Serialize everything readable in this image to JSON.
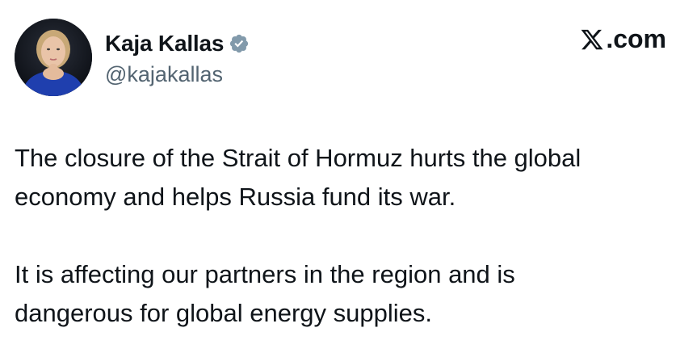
{
  "author": {
    "display_name": "Kaja Kallas",
    "handle": "@kajakallas",
    "verified_icon": "verified-badge-icon",
    "verified_color": "#829aab"
  },
  "brand": {
    "label": ".com",
    "icon": "x-logo-icon"
  },
  "tweet": {
    "paragraphs": [
      {
        "lines": [
          "The closure of the Strait of Hormuz hurts the global",
          "economy and helps Russia fund its war."
        ]
      },
      {
        "lines": [
          "It is affecting our partners in the region and is",
          "dangerous for global energy supplies."
        ]
      }
    ]
  },
  "colors": {
    "text": "#0f1419",
    "secondary_text": "#536471",
    "background": "#ffffff"
  }
}
